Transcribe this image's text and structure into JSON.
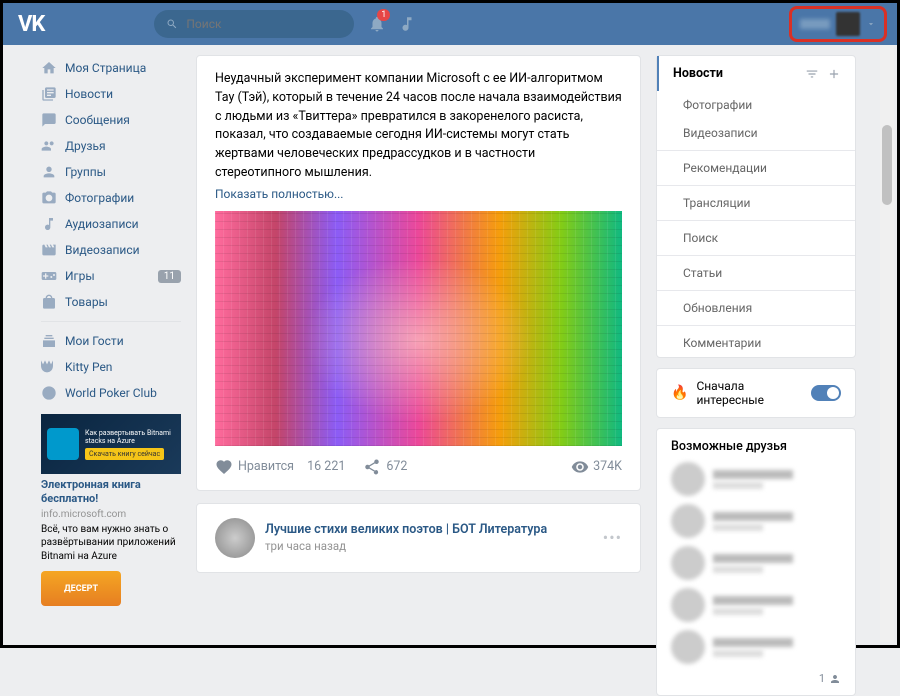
{
  "header": {
    "logo": "VK",
    "search_placeholder": "Поиск",
    "notif_badge": "1"
  },
  "nav": [
    {
      "label": "Моя Страница",
      "icon": "home"
    },
    {
      "label": "Новости",
      "icon": "news"
    },
    {
      "label": "Сообщения",
      "icon": "msg"
    },
    {
      "label": "Друзья",
      "icon": "friends"
    },
    {
      "label": "Группы",
      "icon": "groups"
    },
    {
      "label": "Фотографии",
      "icon": "photos"
    },
    {
      "label": "Аудиозаписи",
      "icon": "audio"
    },
    {
      "label": "Видеозаписи",
      "icon": "video"
    },
    {
      "label": "Игры",
      "icon": "games",
      "count": "11"
    },
    {
      "label": "Товары",
      "icon": "goods"
    }
  ],
  "apps": [
    {
      "label": "Мои Гости"
    },
    {
      "label": "Kitty Pen"
    },
    {
      "label": "World Poker Club"
    }
  ],
  "ad": {
    "img_text": "Как развертывать Bitnami stacks на Azure",
    "img_btn": "Скачать книгу сейчас",
    "title": "Электронная книга бесплатно!",
    "domain": "info.microsoft.com",
    "desc": "Всё, что вам нужно знать о развёртывании приложений Bitnami на Azure"
  },
  "ad2_label": "ДЕСЕРТ",
  "post1": {
    "text": "Неудачный эксперимент компании Microsoft с ее ИИ-алгоритмом Тау (Тэй), который в течение 24 часов после начала взаимодействия с людьми из «Твиттера» превратился в закоренелого расиста, показал, что создаваемые сегодня ИИ-системы могут стать жертвами человеческих предрассудков и в частности стереотипного мышления.",
    "show_more": "Показать полностью...",
    "likes_label": "Нравится",
    "likes_count": "16 221",
    "shares": "672",
    "views": "374K"
  },
  "post2": {
    "author": "Лучшие стихи великих поэтов | БОТ Литература",
    "time": "три часа назад"
  },
  "filters": {
    "head": "Новости",
    "items": [
      "Фотографии",
      "Видеозаписи",
      "Рекомендации",
      "Трансляции",
      "Поиск",
      "Статьи",
      "Обновления",
      "Комментарии"
    ]
  },
  "sort": {
    "label": "Сначала интересные"
  },
  "friends": {
    "title": "Возможные друзья",
    "count": "1"
  }
}
